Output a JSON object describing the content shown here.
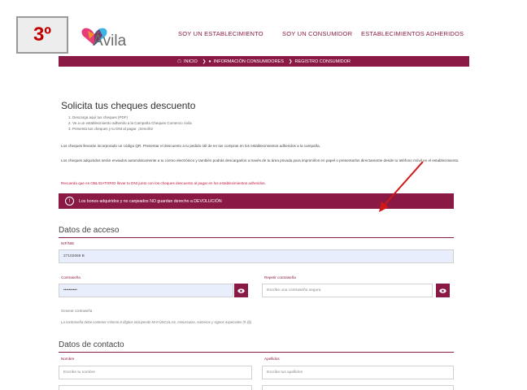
{
  "step_badge": "3º",
  "logo": {
    "text": "Ávila",
    "colors": [
      "#e83a7a",
      "#3bb4e8",
      "#8a1a45",
      "#f0a020"
    ]
  },
  "top_nav": [
    {
      "label": "SOY UN ESTABLECIMIENTO"
    },
    {
      "label": "SOY UN CONSUMIDOR"
    },
    {
      "label": "ESTABLECIMIENTOS ADHERIDOS"
    }
  ],
  "breadcrumb": {
    "home": "INICIO",
    "item1": "INFORMACIÓN CONSUMIDORES",
    "item2": "REGISTRO CONSUMIDOR"
  },
  "title": "Solicita tus cheques descuento",
  "steps": [
    "1. Descarga aquí tus cheques (PDF)",
    "2. Ve a un establecimiento adherido a la Campaña Cheques Comercio Ávila",
    "3. Presenta tus cheques y tu DNI al pagar. ¡Sencillo!"
  ],
  "paragraphs": {
    "p1": "Los cheques llevarán incorporado un código QR. Presentar el descuento a tu pedido útil de en tus compras en los establecimientos adheridos a la campaña.",
    "p2": "Los cheques adquiridos serán enviados automáticamente a tu correo electrónico y también podrás descargarlos a través de tu área privada para imprimirlos en papel o presentarlos directamente desde tu teléfono móvil en el establecimiento.",
    "p3": "Recuerda que es OBLIGATORIO llevar tu DNI junto con los cheques descuento al pagar en los establecimientos adheridos."
  },
  "alert": {
    "icon": "!",
    "text": "Los bonos adquiridos y no canjeados NO guardan derecho a DEVOLUCIÓN"
  },
  "access": {
    "title": "Datos de acceso",
    "nif_label": "NIF/NIE",
    "nif_value": "27102659 B",
    "password_label": "Contraseña",
    "password_value": "••••••••••",
    "repeat_label": "Repetir contraseña",
    "repeat_placeholder": "Escribe una contraseña segura",
    "generate_hint": "Generar contraseña",
    "password_rule": "La contraseña debe contener mínimo 8 dígitos incluyendo MAYÚSCULAS, minúsculas, números y signos especiales (#,@)"
  },
  "contact": {
    "title": "Datos de contacto",
    "name_label": "Nombre",
    "name_placeholder": "Escribe tu nombre",
    "surname_label": "Apellidos",
    "surname_placeholder": "Escribe tus apellidos"
  }
}
